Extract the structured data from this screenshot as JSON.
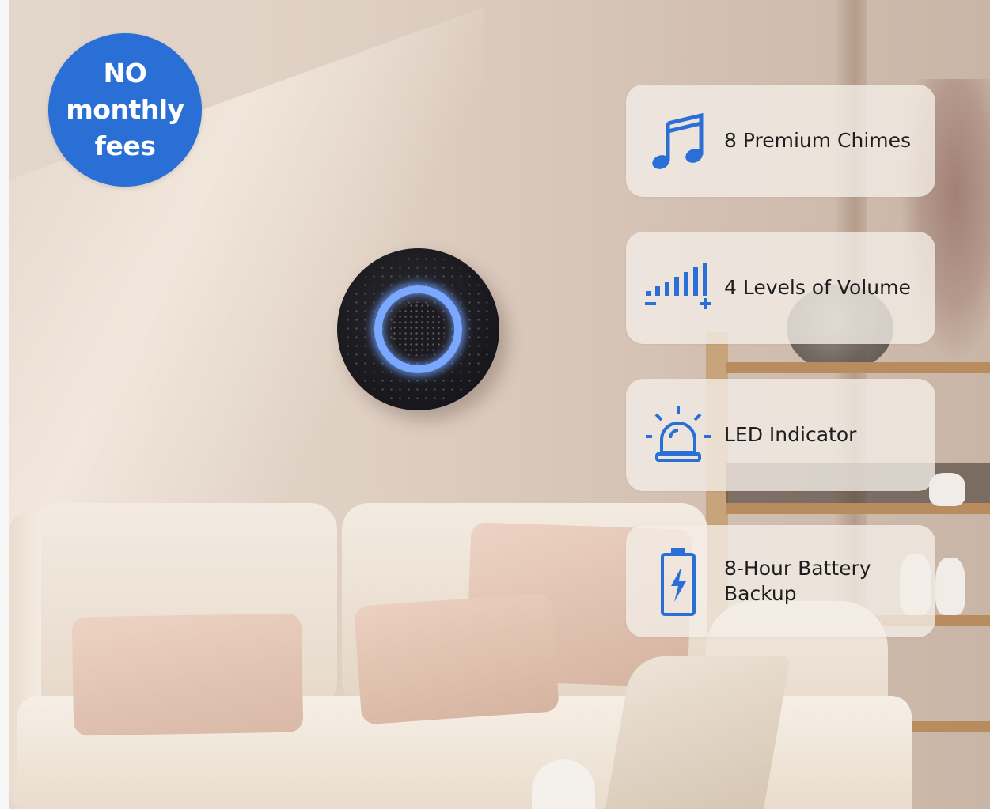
{
  "badge": {
    "text": "NO\nmonthly\nfees",
    "color": "#2a6fd6"
  },
  "features": [
    {
      "label": "8 Premium Chimes",
      "icon": "music-note-icon"
    },
    {
      "label": "4 Levels of Volume",
      "icon": "volume-levels-icon"
    },
    {
      "label": "LED Indicator",
      "icon": "siren-light-icon"
    },
    {
      "label": "8-Hour Battery\nBackup",
      "icon": "battery-icon"
    }
  ],
  "colors": {
    "accent_blue": "#2a6fd6",
    "device_ring": "#7aa8ff",
    "device_body": "#1a191e"
  }
}
